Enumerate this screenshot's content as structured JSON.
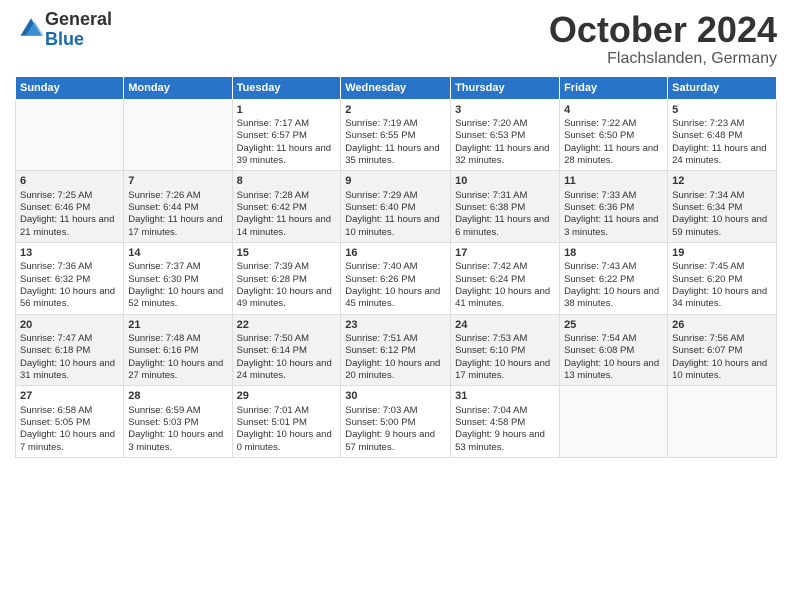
{
  "header": {
    "logo_general": "General",
    "logo_blue": "Blue",
    "month": "October 2024",
    "location": "Flachslanden, Germany"
  },
  "days_of_week": [
    "Sunday",
    "Monday",
    "Tuesday",
    "Wednesday",
    "Thursday",
    "Friday",
    "Saturday"
  ],
  "weeks": [
    [
      {
        "day": "",
        "info": ""
      },
      {
        "day": "",
        "info": ""
      },
      {
        "day": "1",
        "info": "Sunrise: 7:17 AM\nSunset: 6:57 PM\nDaylight: 11 hours and 39 minutes."
      },
      {
        "day": "2",
        "info": "Sunrise: 7:19 AM\nSunset: 6:55 PM\nDaylight: 11 hours and 35 minutes."
      },
      {
        "day": "3",
        "info": "Sunrise: 7:20 AM\nSunset: 6:53 PM\nDaylight: 11 hours and 32 minutes."
      },
      {
        "day": "4",
        "info": "Sunrise: 7:22 AM\nSunset: 6:50 PM\nDaylight: 11 hours and 28 minutes."
      },
      {
        "day": "5",
        "info": "Sunrise: 7:23 AM\nSunset: 6:48 PM\nDaylight: 11 hours and 24 minutes."
      }
    ],
    [
      {
        "day": "6",
        "info": "Sunrise: 7:25 AM\nSunset: 6:46 PM\nDaylight: 11 hours and 21 minutes."
      },
      {
        "day": "7",
        "info": "Sunrise: 7:26 AM\nSunset: 6:44 PM\nDaylight: 11 hours and 17 minutes."
      },
      {
        "day": "8",
        "info": "Sunrise: 7:28 AM\nSunset: 6:42 PM\nDaylight: 11 hours and 14 minutes."
      },
      {
        "day": "9",
        "info": "Sunrise: 7:29 AM\nSunset: 6:40 PM\nDaylight: 11 hours and 10 minutes."
      },
      {
        "day": "10",
        "info": "Sunrise: 7:31 AM\nSunset: 6:38 PM\nDaylight: 11 hours and 6 minutes."
      },
      {
        "day": "11",
        "info": "Sunrise: 7:33 AM\nSunset: 6:36 PM\nDaylight: 11 hours and 3 minutes."
      },
      {
        "day": "12",
        "info": "Sunrise: 7:34 AM\nSunset: 6:34 PM\nDaylight: 10 hours and 59 minutes."
      }
    ],
    [
      {
        "day": "13",
        "info": "Sunrise: 7:36 AM\nSunset: 6:32 PM\nDaylight: 10 hours and 56 minutes."
      },
      {
        "day": "14",
        "info": "Sunrise: 7:37 AM\nSunset: 6:30 PM\nDaylight: 10 hours and 52 minutes."
      },
      {
        "day": "15",
        "info": "Sunrise: 7:39 AM\nSunset: 6:28 PM\nDaylight: 10 hours and 49 minutes."
      },
      {
        "day": "16",
        "info": "Sunrise: 7:40 AM\nSunset: 6:26 PM\nDaylight: 10 hours and 45 minutes."
      },
      {
        "day": "17",
        "info": "Sunrise: 7:42 AM\nSunset: 6:24 PM\nDaylight: 10 hours and 41 minutes."
      },
      {
        "day": "18",
        "info": "Sunrise: 7:43 AM\nSunset: 6:22 PM\nDaylight: 10 hours and 38 minutes."
      },
      {
        "day": "19",
        "info": "Sunrise: 7:45 AM\nSunset: 6:20 PM\nDaylight: 10 hours and 34 minutes."
      }
    ],
    [
      {
        "day": "20",
        "info": "Sunrise: 7:47 AM\nSunset: 6:18 PM\nDaylight: 10 hours and 31 minutes."
      },
      {
        "day": "21",
        "info": "Sunrise: 7:48 AM\nSunset: 6:16 PM\nDaylight: 10 hours and 27 minutes."
      },
      {
        "day": "22",
        "info": "Sunrise: 7:50 AM\nSunset: 6:14 PM\nDaylight: 10 hours and 24 minutes."
      },
      {
        "day": "23",
        "info": "Sunrise: 7:51 AM\nSunset: 6:12 PM\nDaylight: 10 hours and 20 minutes."
      },
      {
        "day": "24",
        "info": "Sunrise: 7:53 AM\nSunset: 6:10 PM\nDaylight: 10 hours and 17 minutes."
      },
      {
        "day": "25",
        "info": "Sunrise: 7:54 AM\nSunset: 6:08 PM\nDaylight: 10 hours and 13 minutes."
      },
      {
        "day": "26",
        "info": "Sunrise: 7:56 AM\nSunset: 6:07 PM\nDaylight: 10 hours and 10 minutes."
      }
    ],
    [
      {
        "day": "27",
        "info": "Sunrise: 6:58 AM\nSunset: 5:05 PM\nDaylight: 10 hours and 7 minutes."
      },
      {
        "day": "28",
        "info": "Sunrise: 6:59 AM\nSunset: 5:03 PM\nDaylight: 10 hours and 3 minutes."
      },
      {
        "day": "29",
        "info": "Sunrise: 7:01 AM\nSunset: 5:01 PM\nDaylight: 10 hours and 0 minutes."
      },
      {
        "day": "30",
        "info": "Sunrise: 7:03 AM\nSunset: 5:00 PM\nDaylight: 9 hours and 57 minutes."
      },
      {
        "day": "31",
        "info": "Sunrise: 7:04 AM\nSunset: 4:58 PM\nDaylight: 9 hours and 53 minutes."
      },
      {
        "day": "",
        "info": ""
      },
      {
        "day": "",
        "info": ""
      }
    ]
  ]
}
